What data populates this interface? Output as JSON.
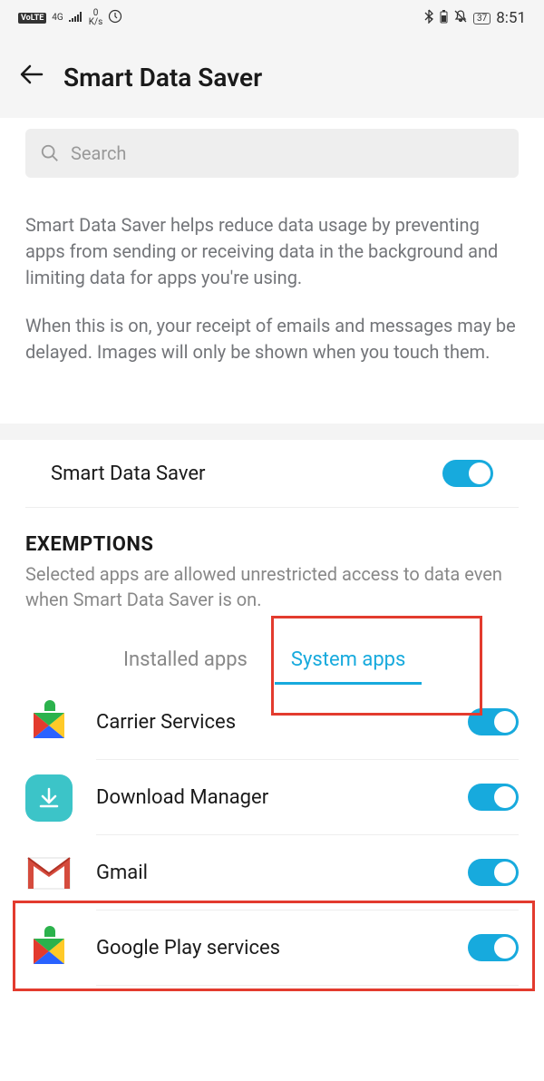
{
  "status_bar": {
    "volte": "VoLTE",
    "net": "4G",
    "speed_top": "0",
    "speed_unit": "K/s",
    "battery": "37",
    "time": "8:51"
  },
  "header": {
    "title": "Smart Data Saver"
  },
  "search": {
    "placeholder": "Search"
  },
  "description": {
    "p1": "Smart Data Saver helps reduce data usage by preventing apps from sending or receiving data in the background and limiting data for apps you're using.",
    "p2": "When this is on, your receipt of emails and messages may be delayed. Images will only be shown when you touch them."
  },
  "main_toggle": {
    "label": "Smart Data Saver",
    "on": true
  },
  "exemptions": {
    "title": "EXEMPTIONS",
    "subtitle": "Selected apps are allowed unrestricted access to data even when Smart Data Saver is on."
  },
  "tabs": {
    "installed": "Installed apps",
    "system": "System apps"
  },
  "apps": [
    {
      "name": "Carrier Services",
      "on": true
    },
    {
      "name": "Download Manager",
      "on": true
    },
    {
      "name": "Gmail",
      "on": true
    },
    {
      "name": "Google Play services",
      "on": true
    }
  ]
}
